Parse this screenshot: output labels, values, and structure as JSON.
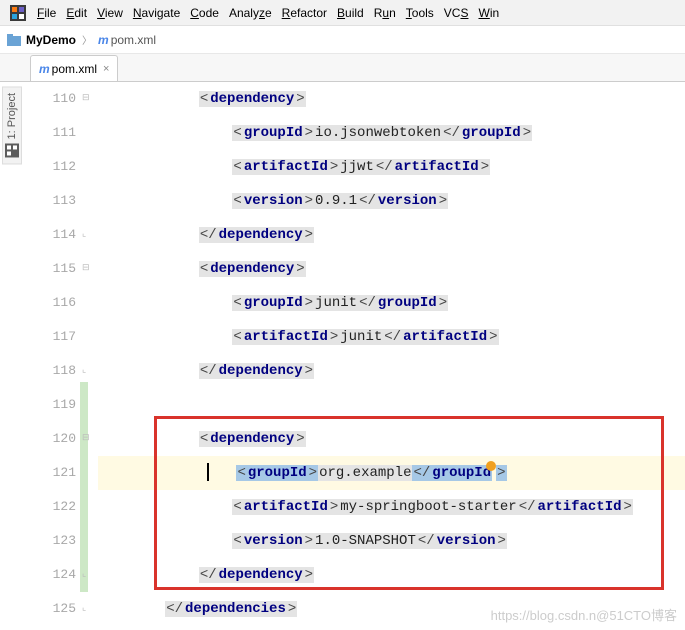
{
  "menu": {
    "items": [
      "File",
      "Edit",
      "View",
      "Navigate",
      "Code",
      "Analyze",
      "Refactor",
      "Build",
      "Run",
      "Tools",
      "VCS",
      "Win"
    ]
  },
  "breadcrumb": {
    "project": "MyDemo",
    "file_prefix": "m",
    "file": "pom.xml"
  },
  "tab": {
    "file_prefix": "m",
    "file": "pom.xml",
    "close": "×"
  },
  "side_tab": {
    "label": "1: Project"
  },
  "gutter": {
    "lines": [
      "110",
      "111",
      "112",
      "113",
      "114",
      "115",
      "116",
      "117",
      "118",
      "119",
      "120",
      "121",
      "122",
      "123",
      "124",
      "125"
    ]
  },
  "code": {
    "l110": {
      "o": "<",
      "t": "dependency",
      "c": ">"
    },
    "l111": {
      "o1": "<",
      "t1": "groupId",
      "c1": ">",
      "v": "io.jsonwebtoken",
      "o2": "</",
      "t2": "groupId",
      "c2": ">"
    },
    "l112": {
      "o1": "<",
      "t1": "artifactId",
      "c1": ">",
      "v": "jjwt",
      "o2": "</",
      "t2": "artifactId",
      "c2": ">"
    },
    "l113": {
      "o1": "<",
      "t1": "version",
      "c1": ">",
      "v": "0.9.1",
      "o2": "</",
      "t2": "version",
      "c2": ">"
    },
    "l114": {
      "o": "</",
      "t": "dependency",
      "c": ">"
    },
    "l115": {
      "o": "<",
      "t": "dependency",
      "c": ">"
    },
    "l116": {
      "o1": "<",
      "t1": "groupId",
      "c1": ">",
      "v": "junit",
      "o2": "</",
      "t2": "groupId",
      "c2": ">"
    },
    "l117": {
      "o1": "<",
      "t1": "artifactId",
      "c1": ">",
      "v": "junit",
      "o2": "</",
      "t2": "artifactId",
      "c2": ">"
    },
    "l118": {
      "o": "</",
      "t": "dependency",
      "c": ">"
    },
    "l119": "",
    "l120": {
      "o": "<",
      "t": "dependency",
      "c": ">"
    },
    "l121": {
      "o1": "<",
      "t1": "groupId",
      "c1": ">",
      "v": "org.example",
      "o2": "</",
      "t2": "groupId",
      "c2": ">"
    },
    "l122": {
      "o1": "<",
      "t1": "artifactId",
      "c1": ">",
      "v": "my-springboot-starter",
      "o2": "</",
      "t2": "artifactId",
      "c2": ">"
    },
    "l123": {
      "o1": "<",
      "t1": "version",
      "c1": ">",
      "v": "1.0-SNAPSHOT",
      "o2": "</",
      "t2": "version",
      "c2": ">"
    },
    "l124": {
      "o": "</",
      "t": "dependency",
      "c": ">"
    },
    "l125": {
      "o": "</",
      "t": "dependencies",
      "c": ">"
    }
  },
  "watermark": "https://blog.csdn.n@51CTO博客"
}
